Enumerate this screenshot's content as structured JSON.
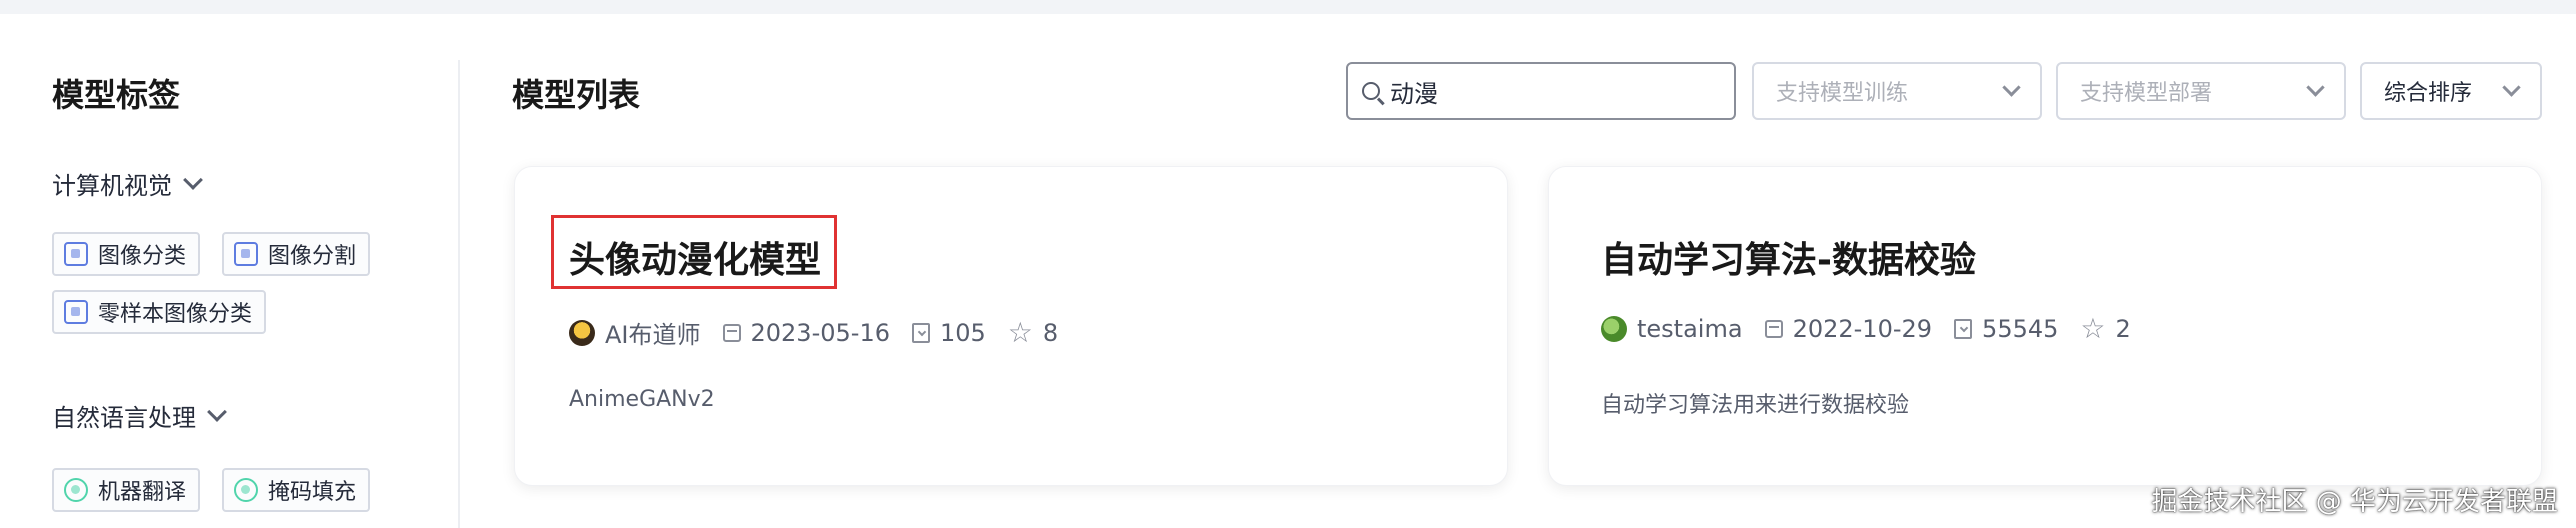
{
  "sidebar": {
    "title": "模型标签",
    "groups": [
      {
        "label": "计算机视觉",
        "tags": [
          "图像分类",
          "图像分割",
          "零样本图像分类"
        ]
      },
      {
        "label": "自然语言处理",
        "tags": [
          "机器翻译",
          "掩码填充"
        ]
      }
    ]
  },
  "main": {
    "title": "模型列表",
    "search": {
      "value": "动漫"
    },
    "filters": {
      "train_placeholder": "支持模型训练",
      "deploy_placeholder": "支持模型部署",
      "sort_value": "综合排序"
    },
    "cards": [
      {
        "title": "头像动漫化模型",
        "author": "AI布道师",
        "date": "2023-05-16",
        "downloads": "105",
        "stars": "8",
        "description": "AnimeGANv2"
      },
      {
        "title": "自动学习算法-数据校验",
        "author": "testaima",
        "date": "2022-10-29",
        "downloads": "55545",
        "stars": "2",
        "description": "自动学习算法用来进行数据校验"
      }
    ]
  },
  "watermark": "掘金技术社区 @ 华为云开发者联盟",
  "colors": {
    "highlight_border": "#e03232",
    "tag_icon_blue": "#5e7ce0",
    "tag_icon_green": "#50d4ab"
  },
  "icons": [
    "search-icon",
    "chevron-down-icon",
    "calendar-icon",
    "download-icon",
    "star-icon",
    "avatar"
  ]
}
